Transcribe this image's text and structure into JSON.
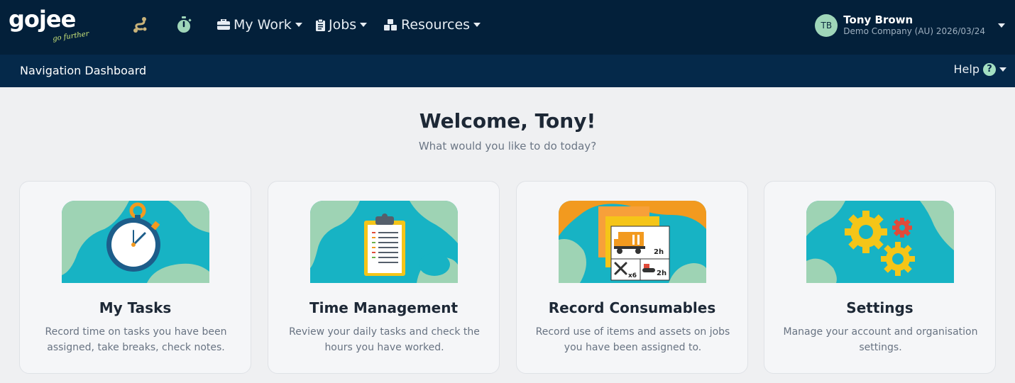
{
  "brand": {
    "logo_text": "gojee",
    "tagline": "go further"
  },
  "nav": {
    "route_icon": "route-icon",
    "timer_icon": "stopwatch-icon",
    "items": [
      {
        "label": "My Work",
        "icon": "briefcase-icon"
      },
      {
        "label": "Jobs",
        "icon": "clipboard-icon"
      },
      {
        "label": "Resources",
        "icon": "cubes-icon"
      }
    ]
  },
  "user": {
    "initials": "TB",
    "name": "Tony Brown",
    "company": "Demo Company (AU) 2026/03/24"
  },
  "subnav": {
    "breadcrumb": "Navigation Dashboard",
    "help_label": "Help",
    "help_icon": "?"
  },
  "welcome": {
    "title": "Welcome, Tony!",
    "subtitle": "What would you like to do today?"
  },
  "cards": [
    {
      "title": "My Tasks",
      "description": "Record time on tasks you have been assigned, take breaks, check notes.",
      "icon": "stopwatch-illustration"
    },
    {
      "title": "Time Management",
      "description": "Review your daily tasks and check the hours you have worked.",
      "icon": "clipboard-illustration"
    },
    {
      "title": "Record Consumables",
      "description": "Record use of items and assets on jobs you have been assigned to.",
      "icon": "consumables-illustration",
      "labels": {
        "truck_hours": "2h",
        "tool_qty": "x6",
        "machine_hours": "2h"
      }
    },
    {
      "title": "Settings",
      "description": "Manage your account and organisation settings.",
      "icon": "gears-illustration"
    }
  ],
  "colors": {
    "topbar": "#03203a",
    "subbar": "#05294a",
    "teal": "#17b3c4",
    "mint": "#9ed3b4",
    "orange": "#f29a1f",
    "yellow": "#f5c518"
  }
}
